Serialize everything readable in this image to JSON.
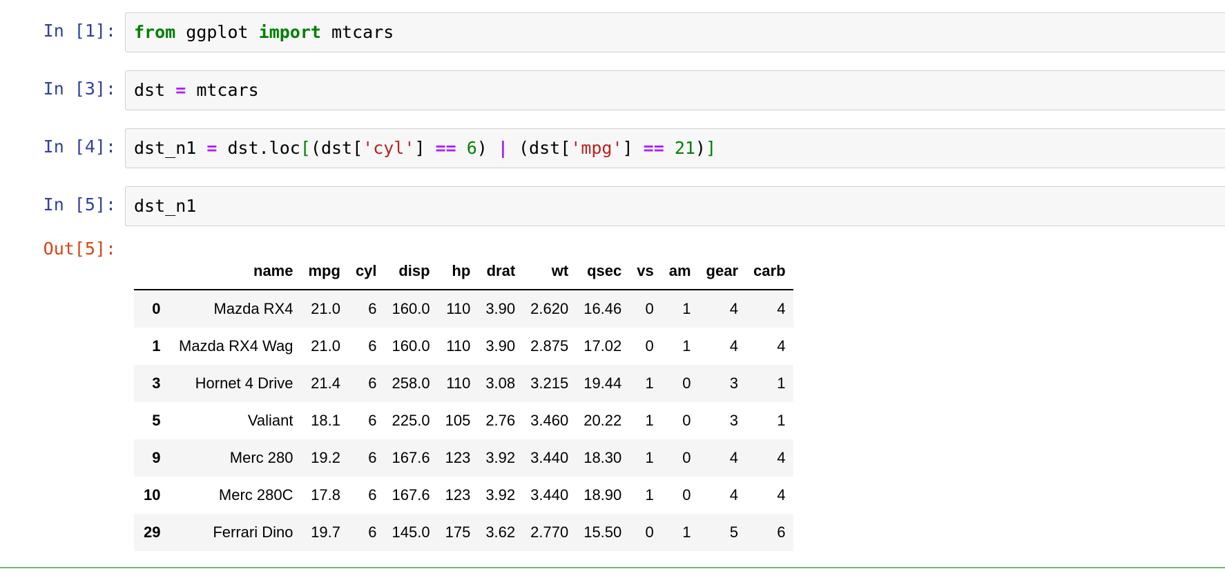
{
  "cells": [
    {
      "prompt": "In [1]:",
      "tokens": [
        {
          "t": "from",
          "c": "kw"
        },
        {
          "t": " ggplot ",
          "c": ""
        },
        {
          "t": "import",
          "c": "kw"
        },
        {
          "t": " mtcars",
          "c": ""
        }
      ]
    },
    {
      "prompt": "In [3]:",
      "tokens": [
        {
          "t": "dst ",
          "c": ""
        },
        {
          "t": "=",
          "c": "op"
        },
        {
          "t": " mtcars",
          "c": ""
        }
      ]
    },
    {
      "prompt": "In [4]:",
      "tokens": [
        {
          "t": "dst_n1 ",
          "c": ""
        },
        {
          "t": "=",
          "c": "op"
        },
        {
          "t": " dst.loc",
          "c": ""
        },
        {
          "t": "[",
          "c": "brk-g"
        },
        {
          "t": "(dst[",
          "c": ""
        },
        {
          "t": "'cyl'",
          "c": "str"
        },
        {
          "t": "] ",
          "c": ""
        },
        {
          "t": "==",
          "c": "op"
        },
        {
          "t": " ",
          "c": ""
        },
        {
          "t": "6",
          "c": "num"
        },
        {
          "t": ") ",
          "c": ""
        },
        {
          "t": "|",
          "c": "op"
        },
        {
          "t": " (dst[",
          "c": ""
        },
        {
          "t": "'mpg'",
          "c": "str"
        },
        {
          "t": "] ",
          "c": ""
        },
        {
          "t": "==",
          "c": "op"
        },
        {
          "t": " ",
          "c": ""
        },
        {
          "t": "21",
          "c": "num"
        },
        {
          "t": ")",
          "c": ""
        },
        {
          "t": "]",
          "c": "brk-g"
        }
      ]
    },
    {
      "prompt": "In [5]:",
      "tokens": [
        {
          "t": "dst_n1",
          "c": ""
        }
      ]
    }
  ],
  "output": {
    "prompt": "Out[5]:",
    "table": {
      "columns": [
        "",
        "name",
        "mpg",
        "cyl",
        "disp",
        "hp",
        "drat",
        "wt",
        "qsec",
        "vs",
        "am",
        "gear",
        "carb"
      ],
      "rows": [
        [
          "0",
          "Mazda RX4",
          "21.0",
          "6",
          "160.0",
          "110",
          "3.90",
          "2.620",
          "16.46",
          "0",
          "1",
          "4",
          "4"
        ],
        [
          "1",
          "Mazda RX4 Wag",
          "21.0",
          "6",
          "160.0",
          "110",
          "3.90",
          "2.875",
          "17.02",
          "0",
          "1",
          "4",
          "4"
        ],
        [
          "3",
          "Hornet 4 Drive",
          "21.4",
          "6",
          "258.0",
          "110",
          "3.08",
          "3.215",
          "19.44",
          "1",
          "0",
          "3",
          "1"
        ],
        [
          "5",
          "Valiant",
          "18.1",
          "6",
          "225.0",
          "105",
          "2.76",
          "3.460",
          "20.22",
          "1",
          "0",
          "3",
          "1"
        ],
        [
          "9",
          "Merc 280",
          "19.2",
          "6",
          "167.6",
          "123",
          "3.92",
          "3.440",
          "18.30",
          "1",
          "0",
          "4",
          "4"
        ],
        [
          "10",
          "Merc 280C",
          "17.8",
          "6",
          "167.6",
          "123",
          "3.92",
          "3.440",
          "18.90",
          "1",
          "0",
          "4",
          "4"
        ],
        [
          "29",
          "Ferrari Dino",
          "19.7",
          "6",
          "145.0",
          "175",
          "3.62",
          "2.770",
          "15.50",
          "0",
          "1",
          "5",
          "6"
        ]
      ]
    }
  },
  "colors": {
    "prompt_in": "#303f9f",
    "prompt_out": "#d84315",
    "keyword": "#008000",
    "operator": "#aa22ff",
    "string": "#ba2121",
    "number": "#008000",
    "selected_cell_border": "#66bb6a"
  }
}
